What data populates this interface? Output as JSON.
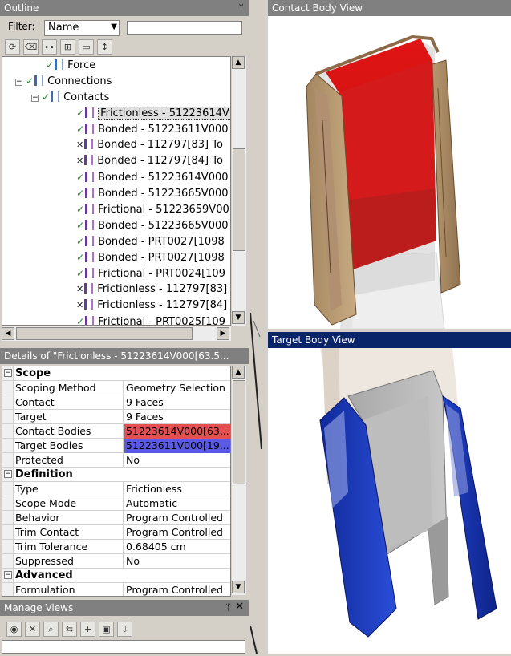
{
  "outline": {
    "title": "Outline",
    "filter_label": "Filter:",
    "filter_value": "Name",
    "filter_text": "",
    "toolbar_icons": [
      "refresh-icon",
      "clear-icon",
      "tree-icon",
      "expand-icon",
      "folder-icon",
      "sort-icon"
    ],
    "tree": [
      {
        "label": "Force",
        "status": "check",
        "level": 3
      },
      {
        "label": "Connections",
        "status": "check",
        "level": 2,
        "expander": "−"
      },
      {
        "label": "Contacts",
        "status": "check",
        "level": 3,
        "expander": "−"
      },
      {
        "label": "Frictionless - 51223614V",
        "status": "check",
        "level": 4,
        "selected": true
      },
      {
        "label": "Bonded - 51223611V000",
        "status": "check",
        "level": 4
      },
      {
        "label": "Bonded - 112797[83] To",
        "status": "x",
        "level": 4
      },
      {
        "label": "Bonded - 112797[84] To",
        "status": "x",
        "level": 4
      },
      {
        "label": "Bonded - 51223614V000",
        "status": "check",
        "level": 4
      },
      {
        "label": "Bonded - 51223665V000",
        "status": "check",
        "level": 4
      },
      {
        "label": "Frictional - 51223659V00",
        "status": "check",
        "level": 4
      },
      {
        "label": "Bonded - 51223665V000",
        "status": "check",
        "level": 4
      },
      {
        "label": "Bonded - PRT0027[1098",
        "status": "check",
        "level": 4
      },
      {
        "label": "Bonded - PRT0027[1098",
        "status": "check",
        "level": 4
      },
      {
        "label": "Frictional - PRT0024[109",
        "status": "check",
        "level": 4
      },
      {
        "label": "Frictionless - 112797[83]",
        "status": "x",
        "level": 4
      },
      {
        "label": "Frictionless - 112797[84]",
        "status": "x",
        "level": 4
      },
      {
        "label": "Frictional - PRT0025[109",
        "status": "check",
        "level": 4
      }
    ]
  },
  "details": {
    "title": "Details of \"Frictionless - 51223614V000[63.5...",
    "groups": [
      {
        "name": "Scope",
        "rows": [
          {
            "key": "Scoping Method",
            "value": "Geometry Selection"
          },
          {
            "key": "Contact",
            "value": "9 Faces"
          },
          {
            "key": "Target",
            "value": "9 Faces"
          },
          {
            "key": "Contact Bodies",
            "value": "51223614V000[63,...",
            "color": "#e45050"
          },
          {
            "key": "Target Bodies",
            "value": "51223611V000[19...",
            "color": "#5a5ae6"
          },
          {
            "key": "Protected",
            "value": "No"
          }
        ]
      },
      {
        "name": "Definition",
        "rows": [
          {
            "key": "Type",
            "value": "Frictionless"
          },
          {
            "key": "Scope Mode",
            "value": "Automatic"
          },
          {
            "key": "Behavior",
            "value": "Program Controlled"
          },
          {
            "key": "Trim Contact",
            "value": "Program Controlled"
          },
          {
            "key": "Trim Tolerance",
            "value": "0.68405 cm"
          },
          {
            "key": "Suppressed",
            "value": "No"
          }
        ]
      },
      {
        "name": "Advanced",
        "rows": [
          {
            "key": "Formulation",
            "value": "Program Controlled"
          }
        ]
      }
    ]
  },
  "manage_views": {
    "title": "Manage Views",
    "toolbar_icons": [
      "view-icon",
      "delete-icon",
      "find-icon",
      "compare-icon",
      "add-view-icon",
      "save-view-icon",
      "import-icon"
    ]
  },
  "contact_view": {
    "title": "Contact Body View"
  },
  "target_view": {
    "title": "Target Body View"
  }
}
